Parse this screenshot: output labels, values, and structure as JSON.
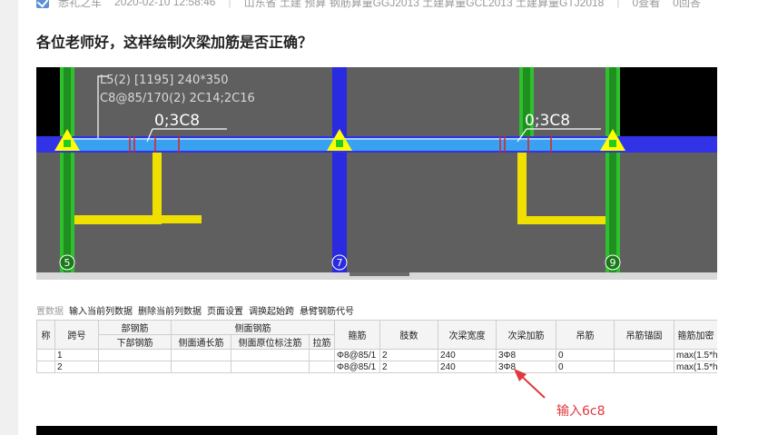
{
  "meta": {
    "author": "悉礼之车",
    "date": "2020-02-10 12:58:46",
    "tags": "山东省 土建 预算 钢筋算量GGJ2013 土建算量GCL2013 土建算量GTJ2018",
    "views": "0查看",
    "answers": "0回答"
  },
  "question": {
    "title": "各位老师好，这样绘制次梁加筋是否正确？"
  },
  "cad": {
    "beam_label_line1": "L5(2) [1195] 240*350",
    "beam_label_line2": "C8@85/170(2) 2C14;2C16",
    "left_rebar_label": "0;3C8",
    "right_rebar_label": "0;3C8",
    "axis_left": "5",
    "axis_mid": "7",
    "axis_right": "9"
  },
  "toolbar": {
    "items": [
      "置数据",
      "输入当前列数据",
      "删除当前列数据",
      "页面设置",
      "调换起始跨",
      "悬臂钢筋代号"
    ]
  },
  "table": {
    "header_top": [
      "称",
      "跨号",
      "部钢筋",
      "侧面钢筋",
      "箍筋",
      "肢数",
      "次梁宽度",
      "次梁加筋",
      "吊筋",
      "吊筋锚固",
      "箍筋加密"
    ],
    "header_sub": [
      "下部钢筋",
      "侧面通长筋",
      "侧面原位标注筋",
      "拉筋"
    ],
    "rows": [
      {
        "span": "1",
        "stirrup": "Φ8@85/1",
        "legs": "2",
        "width": "240",
        "add_bar": "3Φ8",
        "hanger": "0",
        "hanger_anchor": "",
        "dense": "max(1.5*h,"
      },
      {
        "span": "2",
        "stirrup": "Φ8@85/1",
        "legs": "2",
        "width": "240",
        "add_bar": "3Φ8",
        "hanger": "0",
        "hanger_anchor": "",
        "dense": "max(1.5*h,"
      }
    ]
  },
  "annotation": {
    "text": "输入6c8",
    "color": "#e0393e"
  }
}
